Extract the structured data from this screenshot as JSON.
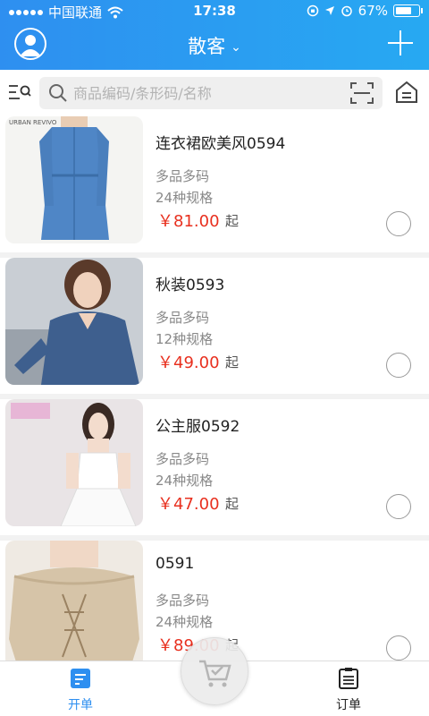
{
  "status": {
    "carrier": "中国联通",
    "time": "17:38",
    "battery": "67%"
  },
  "header": {
    "title": "散客"
  },
  "search": {
    "placeholder": "商品编码/条形码/名称"
  },
  "products": [
    {
      "name": "连衣裙欧美风0594",
      "desc": "多品多码",
      "spec": "24种规格",
      "price": "￥81.00",
      "suffix": "起"
    },
    {
      "name": "秋装0593",
      "desc": "多品多码",
      "spec": "12种规格",
      "price": "￥49.00",
      "suffix": "起"
    },
    {
      "name": "公主服0592",
      "desc": "多品多码",
      "spec": "24种规格",
      "price": "￥47.00",
      "suffix": "起"
    },
    {
      "name": "0591",
      "desc": "多品多码",
      "spec": "24种规格",
      "price": "￥89.00",
      "suffix": "起"
    }
  ],
  "tabs": {
    "open": "开单",
    "order": "订单"
  },
  "thumb_labels": {
    "p0": "URBAN REVIVO"
  },
  "colors": {
    "primary": "#2e8ff0",
    "price": "#e8301f"
  }
}
